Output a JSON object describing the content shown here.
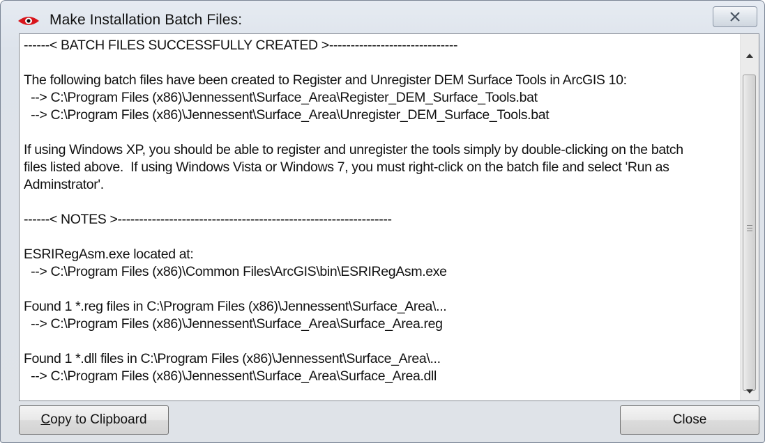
{
  "window": {
    "title": "Make Installation Batch Files:",
    "app_icon": "eye-icon",
    "close_icon": "close-x-icon"
  },
  "output": {
    "lines": [
      "------< BATCH FILES SUCCESSFULLY CREATED >------------------------------",
      "",
      "The following batch files have been created to Register and Unregister DEM Surface Tools in ArcGIS 10:",
      "  --> C:\\Program Files (x86)\\Jennessent\\Surface_Area\\Register_DEM_Surface_Tools.bat",
      "  --> C:\\Program Files (x86)\\Jennessent\\Surface_Area\\Unregister_DEM_Surface_Tools.bat",
      "",
      "If using Windows XP, you should be able to register and unregister the tools simply by double-clicking on the batch",
      "files listed above.  If using Windows Vista or Windows 7, you must right-click on the batch file and select 'Run as",
      "Adminstrator'.",
      "",
      "------< NOTES >----------------------------------------------------------------",
      "",
      "ESRIRegAsm.exe located at:",
      "  --> C:\\Program Files (x86)\\Common Files\\ArcGIS\\bin\\ESRIRegAsm.exe",
      "",
      "Found 1 *.reg files in C:\\Program Files (x86)\\Jennessent\\Surface_Area\\...",
      "  --> C:\\Program Files (x86)\\Jennessent\\Surface_Area\\Surface_Area.reg",
      "",
      "Found 1 *.dll files in C:\\Program Files (x86)\\Jennessent\\Surface_Area\\...",
      "  --> C:\\Program Files (x86)\\Jennessent\\Surface_Area\\Surface_Area.dll"
    ]
  },
  "buttons": {
    "copy_label_first": "C",
    "copy_label_rest": "opy to Clipboard",
    "close_label": "Close"
  },
  "colors": {
    "icon_red": "#d8141b",
    "window_bg": "#dfe3e8",
    "text": "#111111"
  }
}
